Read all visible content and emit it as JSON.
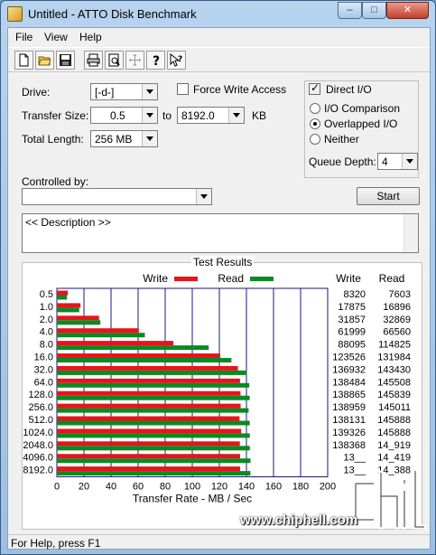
{
  "window": {
    "title": "Untitled - ATTO Disk Benchmark",
    "minimize": "–",
    "maximize": "□",
    "close": "✕"
  },
  "menu": [
    "File",
    "View",
    "Help"
  ],
  "toolbar": [
    "new-icon",
    "open-icon",
    "save-icon",
    "print-icon",
    "print-preview-icon",
    "move-icon",
    "help-icon",
    "context-help-icon"
  ],
  "drive": {
    "label": "Drive:",
    "value": "[-d-]"
  },
  "force_write": {
    "label": "Force Write Access",
    "checked": false
  },
  "direct_io": {
    "label": "Direct I/O",
    "checked": true
  },
  "transfer": {
    "label": "Transfer Size:",
    "from": "0.5",
    "to_label": "to",
    "to": "8192.0",
    "unit": "KB"
  },
  "total_length": {
    "label": "Total Length:",
    "value": "256 MB"
  },
  "io_mode": {
    "options": [
      "I/O Comparison",
      "Overlapped I/O",
      "Neither"
    ],
    "selected": "Overlapped I/O"
  },
  "queue_depth": {
    "label": "Queue Depth:",
    "value": "4"
  },
  "controlled_by": {
    "label": "Controlled by:",
    "value": ""
  },
  "start_button": "Start",
  "description": "<< Description >>",
  "results": {
    "title": "Test Results",
    "write_label": "Write",
    "read_label": "Read",
    "write_col": "Write",
    "read_col": "Read",
    "write_color": "#e8141b",
    "read_color": "#0b8a22"
  },
  "chart_data": {
    "type": "bar",
    "orientation": "horizontal",
    "categories": [
      "0.5",
      "1.0",
      "2.0",
      "4.0",
      "8.0",
      "16.0",
      "32.0",
      "64.0",
      "128.0",
      "256.0",
      "512.0",
      "1024.0",
      "2048.0",
      "4096.0",
      "8192.0"
    ],
    "series": [
      {
        "name": "Write",
        "values": [
          8320,
          17875,
          31857,
          61999,
          88095,
          123526,
          136932,
          138484,
          138865,
          138959,
          138131,
          139326,
          138368,
          138600,
          138606
        ]
      },
      {
        "name": "Read",
        "values": [
          7603,
          16896,
          32869,
          66560,
          114825,
          131984,
          143430,
          145508,
          145839,
          145011,
          145888,
          145888,
          145919,
          146419,
          146388
        ]
      }
    ],
    "write_text": [
      "8320",
      "17875",
      "31857",
      "61999",
      "88095",
      "123526",
      "136932",
      "138484",
      "138865",
      "138959",
      "138131",
      "139326",
      "138368",
      "13__",
      "13__"
    ],
    "read_text": [
      "7603",
      "16896",
      "32869",
      "66560",
      "114825",
      "131984",
      "143430",
      "145508",
      "145839",
      "145011",
      "145888",
      "145888",
      "14_919",
      "14_419",
      "14_388"
    ],
    "xlabel": "Transfer Rate - MB / Sec",
    "xticks": [
      0,
      20,
      40,
      60,
      80,
      100,
      120,
      140,
      160,
      180,
      200
    ],
    "xlim": [
      0,
      200
    ],
    "unit_scale": 1024,
    "legend": "top"
  },
  "status": "For Help, press F1",
  "watermark": "www.chiphell.com"
}
